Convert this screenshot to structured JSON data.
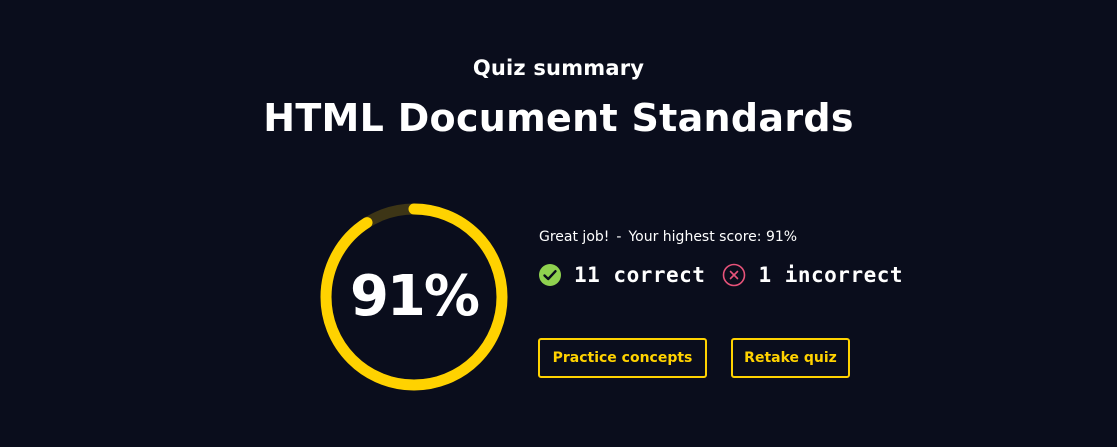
{
  "summary": {
    "eyebrow": "Quiz summary",
    "title": "HTML Document Standards"
  },
  "score": {
    "label": "91%",
    "percent": 91
  },
  "feedback": {
    "message": "Great job!",
    "separator": "-",
    "highest_score": "Your highest score: 91%"
  },
  "stats": {
    "correct_label": "11 correct",
    "incorrect_label": "1 incorrect"
  },
  "actions": {
    "practice_label": "Practice concepts",
    "retake_label": "Retake quiz"
  },
  "colors": {
    "background": "#0a0d1c",
    "accent": "#ffd200",
    "ring_track": "#3d3516",
    "correct": "#8fd14f",
    "incorrect": "#e8537a"
  }
}
